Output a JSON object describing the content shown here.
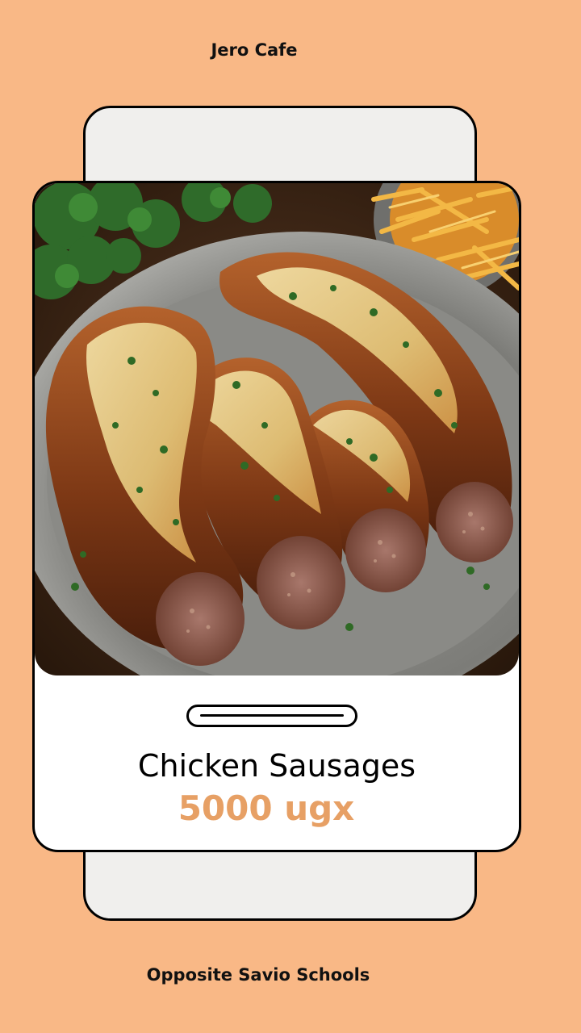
{
  "brand": {
    "name": "Jero Cafe"
  },
  "product": {
    "image_alt": "Chicken sausages topped with melted cheese and parsley on a plate",
    "name": "Chicken Sausages",
    "price": "5000 ugx"
  },
  "footer": {
    "location": "Opposite Savio Schools"
  },
  "colors": {
    "background": "#f9b886",
    "price": "#e7a065",
    "card": "#ffffff",
    "back_card": "#f0efed"
  }
}
